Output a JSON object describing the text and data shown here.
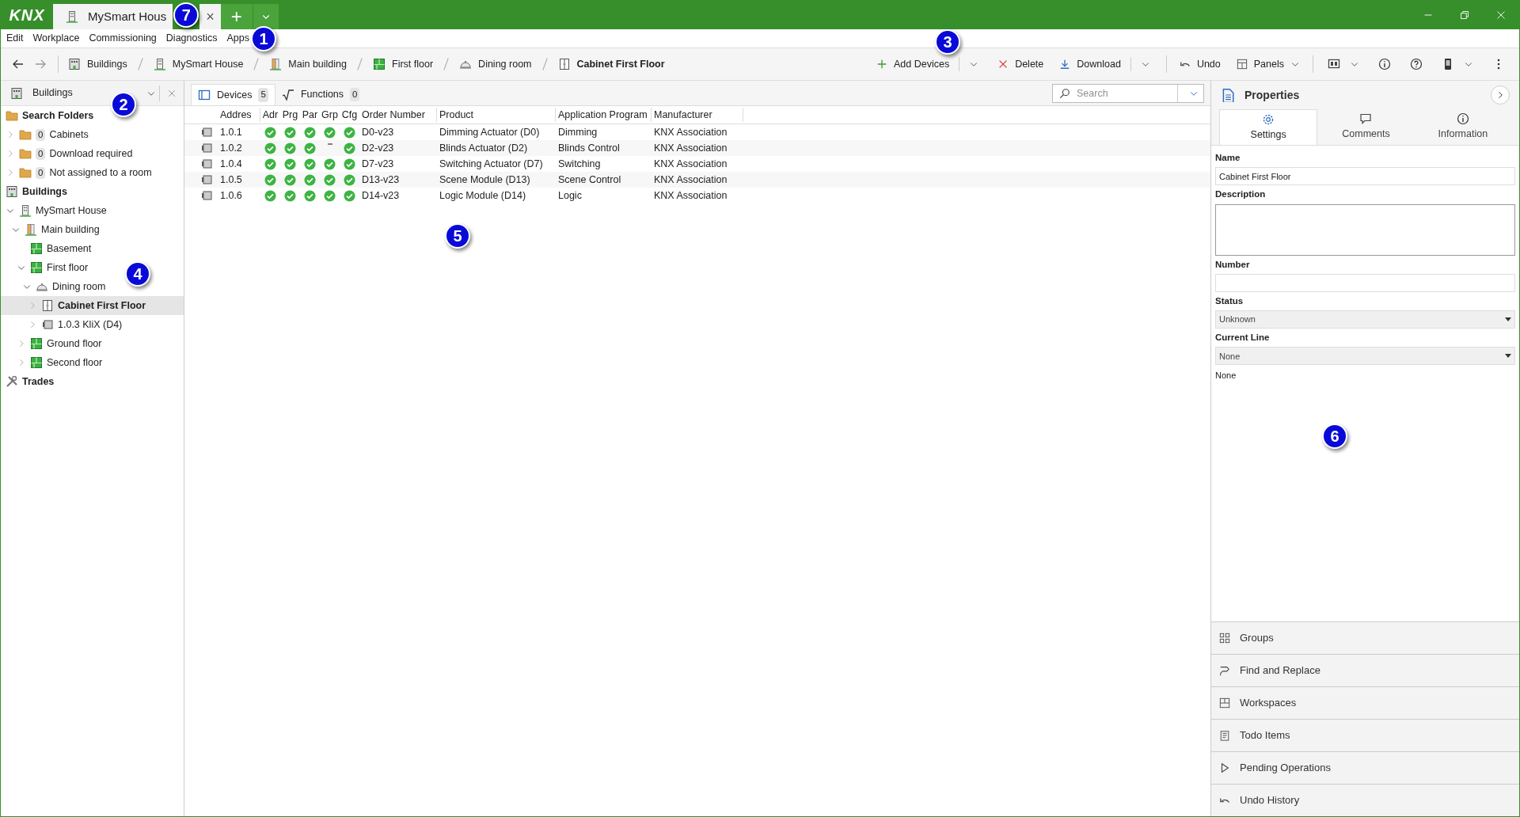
{
  "title_bar": {
    "logo": "KNX",
    "tab": {
      "title": "MySmart Hous",
      "close": "×",
      "callout": "7"
    },
    "new_tab": "+"
  },
  "menu": {
    "items": [
      "Edit",
      "Workplace",
      "Commissioning",
      "Diagnostics",
      "Apps"
    ],
    "callout": "1"
  },
  "toolbar": {
    "breadcrumbs": [
      {
        "label": "Buildings",
        "kind": "buildings",
        "current": false
      },
      {
        "label": "MySmart House",
        "kind": "house",
        "current": false
      },
      {
        "label": "Main building",
        "kind": "wing",
        "current": false
      },
      {
        "label": "First floor",
        "kind": "floor",
        "current": false
      },
      {
        "label": "Dining room",
        "kind": "room",
        "current": false
      },
      {
        "label": "Cabinet First Floor",
        "kind": "cabinet",
        "current": true
      }
    ],
    "actions": [
      {
        "label": "Add Devices",
        "kind": "add",
        "dropdown": true
      },
      {
        "label": "Delete",
        "kind": "delete",
        "dropdown": false
      },
      {
        "label": "Download",
        "kind": "download",
        "dropdown": true
      },
      {
        "label": "Undo",
        "kind": "undo",
        "dropdown": false
      },
      {
        "label": "Panels",
        "kind": "panels",
        "dropdown": true
      }
    ],
    "icon_buttons": [
      {
        "kind": "monitor",
        "dropdown": true
      },
      {
        "kind": "info",
        "dropdown": false
      },
      {
        "kind": "help",
        "dropdown": false
      },
      {
        "kind": "device",
        "dropdown": true
      },
      {
        "kind": "more",
        "dropdown": false
      }
    ],
    "callout": "3"
  },
  "left_panel": {
    "title": "Buildings",
    "callout": "2",
    "tree_callout": "4",
    "tree": [
      {
        "label": "Search Folders",
        "kind": "folder",
        "heading": true,
        "children": [
          {
            "label": "Cabinets",
            "kind": "folder",
            "count": "0",
            "expanded": false,
            "selected": false
          },
          {
            "label": "Download required",
            "kind": "folder",
            "count": "0",
            "expanded": false,
            "selected": false
          },
          {
            "label": "Not assigned to a room",
            "kind": "folder",
            "count": "0",
            "expanded": false,
            "selected": false
          }
        ]
      },
      {
        "label": "Buildings",
        "kind": "buildings",
        "heading": true,
        "children": [
          {
            "label": "MySmart House",
            "kind": "house",
            "expanded": true,
            "selected": false,
            "children": [
              {
                "label": "Main building",
                "kind": "wing",
                "expanded": true,
                "selected": false,
                "children": [
                  {
                    "label": "Basement",
                    "kind": "floor",
                    "selected": false
                  },
                  {
                    "label": "First floor",
                    "kind": "floor",
                    "expanded": true,
                    "selected": false,
                    "children": [
                      {
                        "label": "Dining room",
                        "kind": "room",
                        "expanded": true,
                        "selected": false,
                        "children": [
                          {
                            "label": "Cabinet First Floor",
                            "kind": "cabinet",
                            "expanded": false,
                            "selected": true
                          },
                          {
                            "label": "1.0.3 KliX (D4)",
                            "kind": "device",
                            "expanded": false,
                            "selected": false
                          }
                        ]
                      }
                    ]
                  },
                  {
                    "label": "Ground floor",
                    "kind": "floor",
                    "expanded": false,
                    "selected": false
                  },
                  {
                    "label": "Second floor",
                    "kind": "floor",
                    "expanded": false,
                    "selected": false
                  }
                ]
              }
            ]
          }
        ]
      },
      {
        "label": "Trades",
        "kind": "trades",
        "heading": true
      }
    ]
  },
  "devices": {
    "tabs": [
      {
        "label": "Devices",
        "count": "5",
        "kind": "devices",
        "selected": true
      },
      {
        "label": "Functions",
        "count": "0",
        "kind": "functions",
        "selected": false
      }
    ],
    "search": {
      "placeholder": "Search"
    },
    "callout": "5",
    "columns": [
      "Addres",
      "Adr",
      "Prg",
      "Par",
      "Grp",
      "Cfg",
      "Order Number",
      "Product",
      "Application Program",
      "Manufacturer"
    ],
    "rows": [
      {
        "address": "1.0.1",
        "status": [
          true,
          true,
          true,
          true,
          true
        ],
        "order_number": "D0-v23",
        "product": "Dimming Actuator (D0)",
        "application_program": "Dimming",
        "manufacturer": "KNX Association"
      },
      {
        "address": "1.0.2",
        "status": [
          true,
          true,
          true,
          false,
          true
        ],
        "order_number": "D2-v23",
        "product": "Blinds Actuator (D2)",
        "application_program": "Blinds Control",
        "manufacturer": "KNX Association"
      },
      {
        "address": "1.0.4",
        "status": [
          true,
          true,
          true,
          true,
          true
        ],
        "order_number": "D7-v23",
        "product": "Switching Actuator (D7)",
        "application_program": "Switching",
        "manufacturer": "KNX Association"
      },
      {
        "address": "1.0.5",
        "status": [
          true,
          true,
          true,
          true,
          true
        ],
        "order_number": "D13-v23",
        "product": "Scene Module (D13)",
        "application_program": "Scene Control",
        "manufacturer": "KNX Association"
      },
      {
        "address": "1.0.6",
        "status": [
          true,
          true,
          true,
          true,
          true
        ],
        "order_number": "D14-v23",
        "product": "Logic Module (D14)",
        "application_program": "Logic",
        "manufacturer": "KNX Association"
      }
    ]
  },
  "properties": {
    "title": "Properties",
    "callout": "6",
    "tabs": [
      {
        "label": "Settings",
        "kind": "settings",
        "selected": true
      },
      {
        "label": "Comments",
        "kind": "comments",
        "selected": false
      },
      {
        "label": "Information",
        "kind": "info",
        "selected": false
      }
    ],
    "fields": [
      {
        "label": "Name",
        "kind": "text",
        "value": "Cabinet First Floor"
      },
      {
        "label": "Description",
        "kind": "textarea"
      },
      {
        "label": "Number",
        "kind": "text"
      },
      {
        "label": "Status",
        "kind": "select",
        "value": "Unknown"
      },
      {
        "label": "Current Line",
        "kind": "select",
        "value": "None"
      },
      {
        "kind": "note",
        "value": "None"
      }
    ],
    "panels": [
      {
        "label": "Groups",
        "kind": "groups"
      },
      {
        "label": "Find and Replace",
        "kind": "find"
      },
      {
        "label": "Workspaces",
        "kind": "workspaces"
      },
      {
        "label": "Todo Items",
        "kind": "todo"
      },
      {
        "label": "Pending Operations",
        "kind": "pending"
      },
      {
        "label": "Undo History",
        "kind": "undo"
      }
    ]
  }
}
